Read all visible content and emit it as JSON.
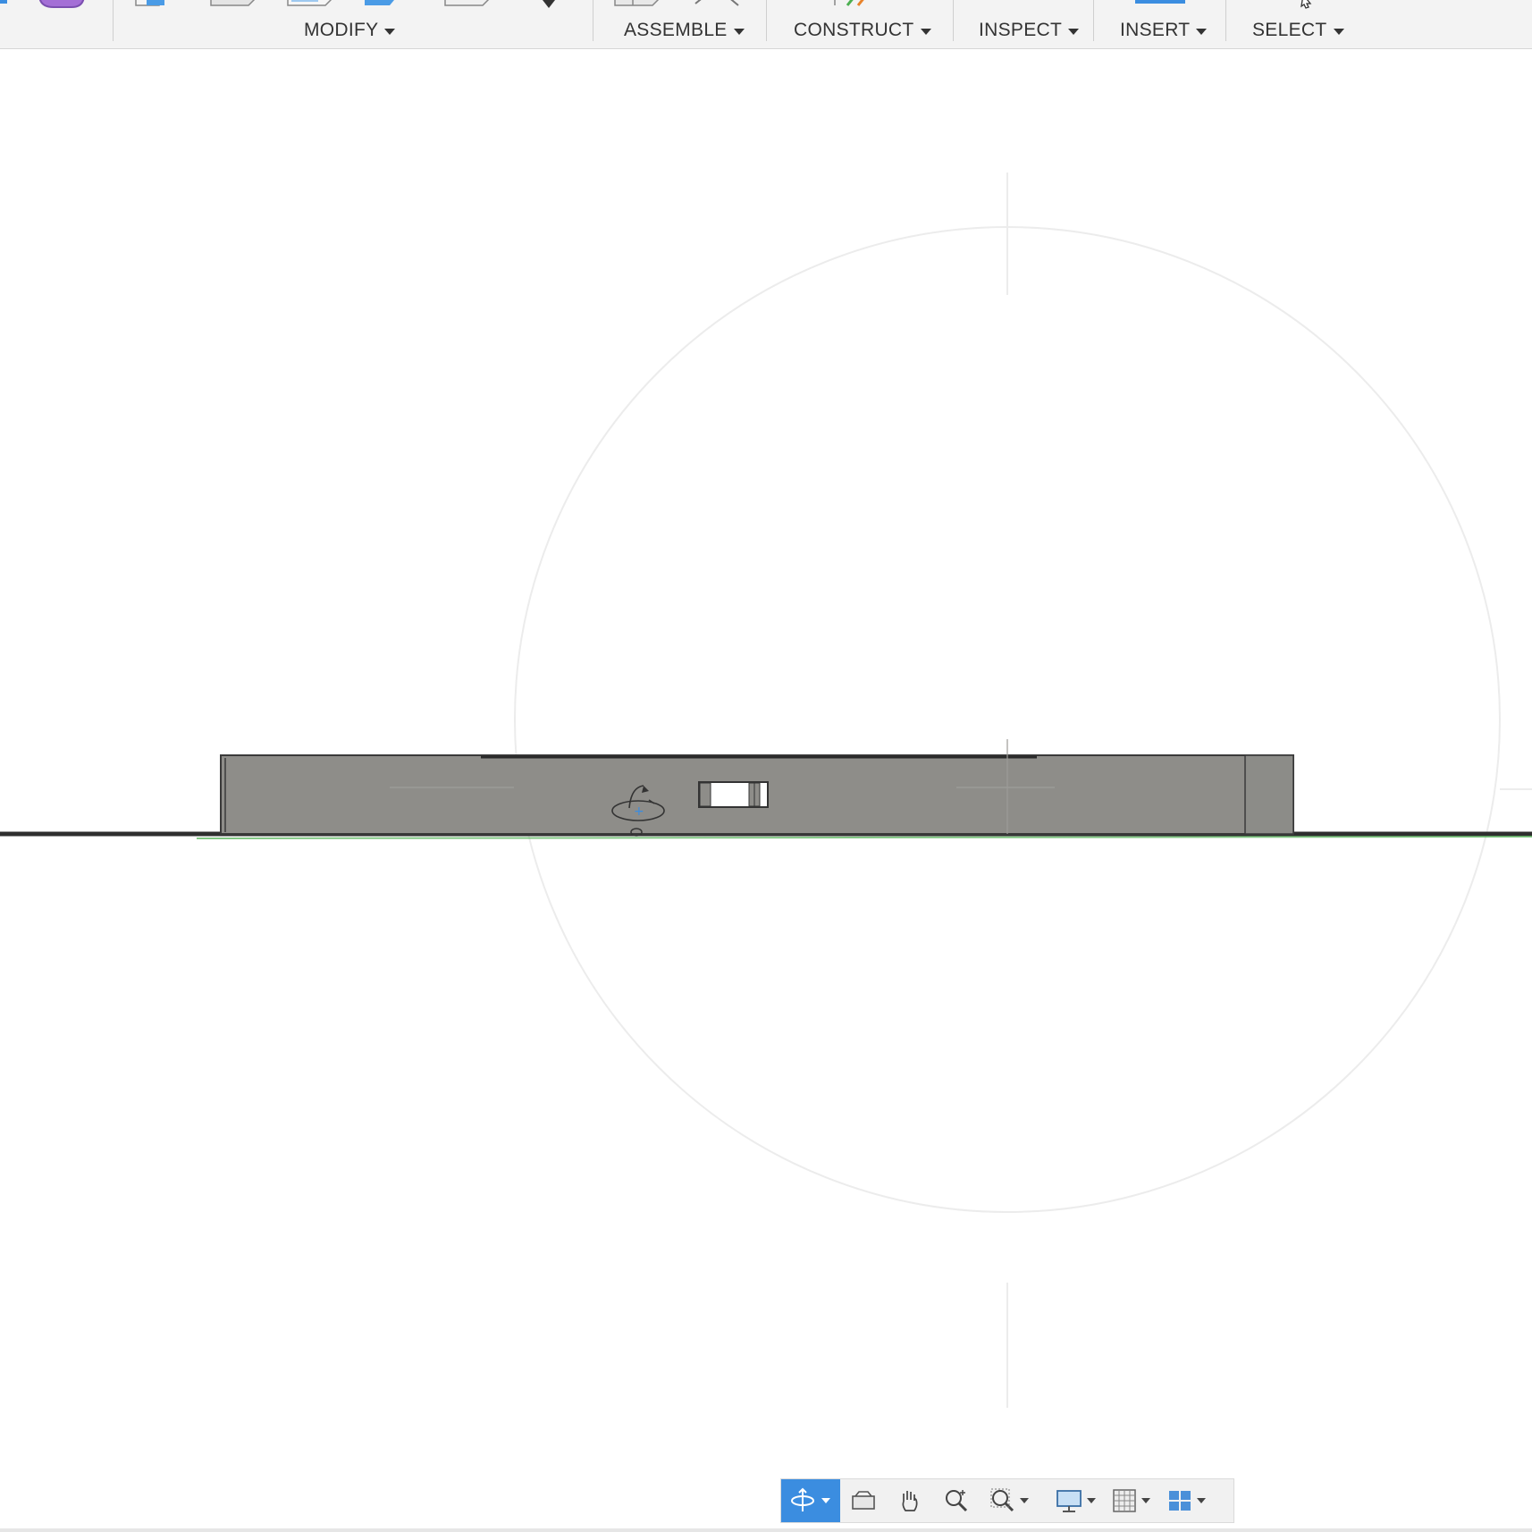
{
  "toolbar": {
    "groups": [
      {
        "label": "MODIFY"
      },
      {
        "label": "ASSEMBLE"
      },
      {
        "label": "CONSTRUCT"
      },
      {
        "label": "INSPECT"
      },
      {
        "label": "INSERT"
      },
      {
        "label": "SELECT"
      }
    ],
    "icons": [
      "solid-body-icon",
      "press-pull-icon",
      "fillet-icon",
      "shell-icon",
      "combine-icon",
      "scale-icon",
      "more-dropdown-icon",
      "new-component-icon",
      "joint-icon",
      "offset-plane-icon",
      "measure-icon",
      "insert-icon",
      "select-cursor-icon"
    ]
  },
  "viewport": {
    "model": "flat rectangular body shown in side view",
    "colors": {
      "body": "#8e8d89",
      "body_edge": "#3a3a3a",
      "ground_line": "#2e2e2e",
      "axis_green": "#4caf50",
      "guide_circle": "#ececec"
    }
  },
  "navbar": {
    "buttons": [
      {
        "name": "orbit-icon",
        "active": true,
        "dropdown": true
      },
      {
        "name": "look-at-icon",
        "active": false,
        "dropdown": false
      },
      {
        "name": "pan-icon",
        "active": false,
        "dropdown": false
      },
      {
        "name": "zoom-icon",
        "active": false,
        "dropdown": false
      },
      {
        "name": "zoom-window-icon",
        "active": false,
        "dropdown": true
      },
      {
        "name": "display-settings-icon",
        "active": false,
        "dropdown": true
      },
      {
        "name": "grid-snaps-icon",
        "active": false,
        "dropdown": true
      },
      {
        "name": "viewports-icon",
        "active": false,
        "dropdown": true
      }
    ],
    "accent": "#3b8de0"
  }
}
